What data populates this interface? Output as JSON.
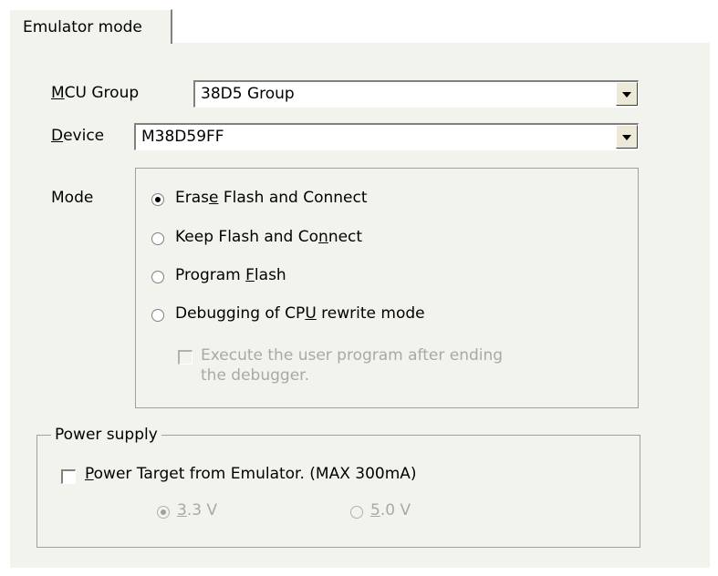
{
  "tab": {
    "label": "Emulator mode"
  },
  "mcu_group": {
    "label_prefix": "M",
    "label_rest": "CU Group",
    "value": "38D5 Group"
  },
  "device": {
    "label_prefix": "D",
    "label_rest": "evice",
    "value": "M38D59FF"
  },
  "mode": {
    "label": "Mode",
    "options": [
      {
        "pre": "Eras",
        "key": "e",
        "post": " Flash and Connect",
        "selected": true
      },
      {
        "pre": "Keep Flash and Co",
        "key": "n",
        "post": "nect",
        "selected": false
      },
      {
        "pre": "Program ",
        "key": "F",
        "post": "lash",
        "selected": false
      },
      {
        "pre": "Debugging of CP",
        "key": "U",
        "post": " rewrite mode",
        "selected": false
      }
    ],
    "execute_checkbox": {
      "line1": "Execute the user program after ending",
      "line2": "the debugger.",
      "checked": false,
      "enabled": false
    }
  },
  "power": {
    "legend": "Power supply",
    "checkbox": {
      "key": "P",
      "rest": "ower Target from Emulator. (MAX 300mA)",
      "checked": false
    },
    "voltages": [
      {
        "key": "3",
        "rest": ".3 V",
        "selected": true,
        "enabled": false
      },
      {
        "key": "5",
        "rest": ".0 V",
        "selected": false,
        "enabled": false
      }
    ]
  }
}
